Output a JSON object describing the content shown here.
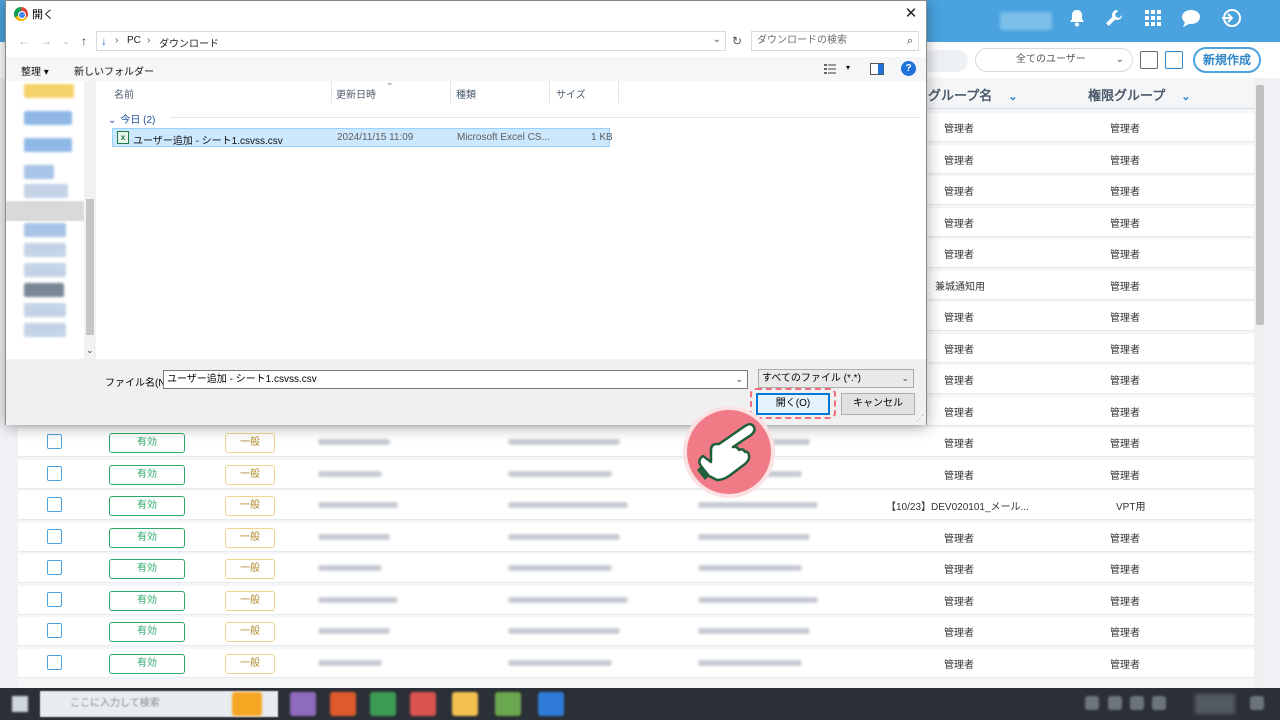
{
  "colors": {
    "accent": "#4aa3df",
    "status_green": "#2fa86a",
    "highlight": "#ef6d7c"
  },
  "app": {
    "header_icons": [
      "bell-icon",
      "wrench-icon",
      "grid-icon",
      "chat-icon",
      "logout-icon"
    ],
    "user_filter": "全てのユーザー",
    "new_button": "新規作成",
    "columns": {
      "group": "グループ名",
      "permission": "権限グループ"
    },
    "rows": [
      {
        "group": "管理者",
        "permission": "管理者"
      },
      {
        "group": "管理者",
        "permission": "管理者"
      },
      {
        "group": "管理者",
        "permission": "管理者"
      },
      {
        "group": "管理者",
        "permission": "管理者"
      },
      {
        "group": "管理者",
        "permission": "管理者"
      },
      {
        "group": "兼城通知用",
        "permission": "管理者"
      },
      {
        "group": "管理者",
        "permission": "管理者"
      },
      {
        "group": "管理者",
        "permission": "管理者"
      },
      {
        "group": "管理者",
        "permission": "管理者"
      },
      {
        "group": "管理者",
        "permission": "管理者"
      },
      {
        "status": "有効",
        "type": "一般",
        "group": "管理者",
        "permission": "管理者"
      },
      {
        "status": "有効",
        "type": "一般",
        "group": "管理者",
        "permission": "管理者"
      },
      {
        "status": "有効",
        "type": "一般",
        "group": "【10/23】DEV020101_メール...",
        "permission": "VPT用"
      },
      {
        "status": "有効",
        "type": "一般",
        "group": "管理者",
        "permission": "管理者"
      },
      {
        "status": "有効",
        "type": "一般",
        "group": "管理者",
        "permission": "管理者"
      },
      {
        "status": "有効",
        "type": "一般",
        "group": "管理者",
        "permission": "管理者"
      },
      {
        "status": "有効",
        "type": "一般",
        "group": "管理者",
        "permission": "管理者"
      },
      {
        "status": "有効",
        "type": "一般",
        "group": "管理者",
        "permission": "管理者"
      }
    ]
  },
  "dialog": {
    "title": "開く",
    "close_icon": "close-icon",
    "breadcrumb": [
      "PC",
      "ダウンロード"
    ],
    "search_placeholder": "ダウンロードの検索",
    "organize": "整理 ▾",
    "new_folder": "新しいフォルダー",
    "columns": [
      "名前",
      "更新日時",
      "種類",
      "サイズ"
    ],
    "group_label": "今日 (2)",
    "file": {
      "name": "ユーザー追加 - シート1.csvss.csv",
      "date": "2024/11/15 11:09",
      "type": "Microsoft Excel CS...",
      "size": "1 KB"
    },
    "filename_label": "ファイル名(N):",
    "filename_value": "ユーザー追加 - シート1.csvss.csv",
    "filetype": "すべてのファイル (*.*)",
    "open_button": "開く(O)",
    "cancel_button": "キャンセル"
  },
  "taskbar": {
    "search_placeholder": "ここに入力して検索"
  }
}
